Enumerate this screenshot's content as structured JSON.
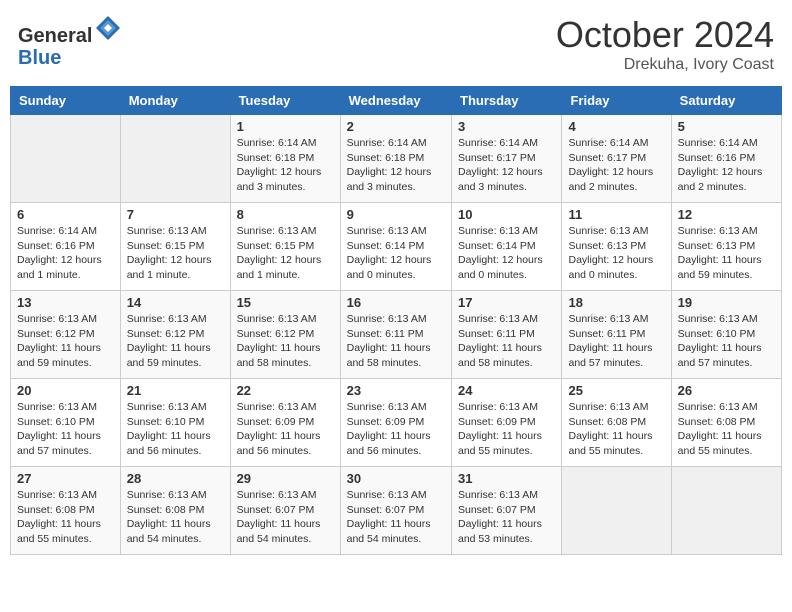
{
  "header": {
    "logo_line1": "General",
    "logo_line2": "Blue",
    "month": "October 2024",
    "location": "Drekuha, Ivory Coast"
  },
  "weekdays": [
    "Sunday",
    "Monday",
    "Tuesday",
    "Wednesday",
    "Thursday",
    "Friday",
    "Saturday"
  ],
  "weeks": [
    [
      {
        "day": "",
        "info": ""
      },
      {
        "day": "",
        "info": ""
      },
      {
        "day": "1",
        "info": "Sunrise: 6:14 AM\nSunset: 6:18 PM\nDaylight: 12 hours and 3 minutes."
      },
      {
        "day": "2",
        "info": "Sunrise: 6:14 AM\nSunset: 6:18 PM\nDaylight: 12 hours and 3 minutes."
      },
      {
        "day": "3",
        "info": "Sunrise: 6:14 AM\nSunset: 6:17 PM\nDaylight: 12 hours and 3 minutes."
      },
      {
        "day": "4",
        "info": "Sunrise: 6:14 AM\nSunset: 6:17 PM\nDaylight: 12 hours and 2 minutes."
      },
      {
        "day": "5",
        "info": "Sunrise: 6:14 AM\nSunset: 6:16 PM\nDaylight: 12 hours and 2 minutes."
      }
    ],
    [
      {
        "day": "6",
        "info": "Sunrise: 6:14 AM\nSunset: 6:16 PM\nDaylight: 12 hours and 1 minute."
      },
      {
        "day": "7",
        "info": "Sunrise: 6:13 AM\nSunset: 6:15 PM\nDaylight: 12 hours and 1 minute."
      },
      {
        "day": "8",
        "info": "Sunrise: 6:13 AM\nSunset: 6:15 PM\nDaylight: 12 hours and 1 minute."
      },
      {
        "day": "9",
        "info": "Sunrise: 6:13 AM\nSunset: 6:14 PM\nDaylight: 12 hours and 0 minutes."
      },
      {
        "day": "10",
        "info": "Sunrise: 6:13 AM\nSunset: 6:14 PM\nDaylight: 12 hours and 0 minutes."
      },
      {
        "day": "11",
        "info": "Sunrise: 6:13 AM\nSunset: 6:13 PM\nDaylight: 12 hours and 0 minutes."
      },
      {
        "day": "12",
        "info": "Sunrise: 6:13 AM\nSunset: 6:13 PM\nDaylight: 11 hours and 59 minutes."
      }
    ],
    [
      {
        "day": "13",
        "info": "Sunrise: 6:13 AM\nSunset: 6:12 PM\nDaylight: 11 hours and 59 minutes."
      },
      {
        "day": "14",
        "info": "Sunrise: 6:13 AM\nSunset: 6:12 PM\nDaylight: 11 hours and 59 minutes."
      },
      {
        "day": "15",
        "info": "Sunrise: 6:13 AM\nSunset: 6:12 PM\nDaylight: 11 hours and 58 minutes."
      },
      {
        "day": "16",
        "info": "Sunrise: 6:13 AM\nSunset: 6:11 PM\nDaylight: 11 hours and 58 minutes."
      },
      {
        "day": "17",
        "info": "Sunrise: 6:13 AM\nSunset: 6:11 PM\nDaylight: 11 hours and 58 minutes."
      },
      {
        "day": "18",
        "info": "Sunrise: 6:13 AM\nSunset: 6:11 PM\nDaylight: 11 hours and 57 minutes."
      },
      {
        "day": "19",
        "info": "Sunrise: 6:13 AM\nSunset: 6:10 PM\nDaylight: 11 hours and 57 minutes."
      }
    ],
    [
      {
        "day": "20",
        "info": "Sunrise: 6:13 AM\nSunset: 6:10 PM\nDaylight: 11 hours and 57 minutes."
      },
      {
        "day": "21",
        "info": "Sunrise: 6:13 AM\nSunset: 6:10 PM\nDaylight: 11 hours and 56 minutes."
      },
      {
        "day": "22",
        "info": "Sunrise: 6:13 AM\nSunset: 6:09 PM\nDaylight: 11 hours and 56 minutes."
      },
      {
        "day": "23",
        "info": "Sunrise: 6:13 AM\nSunset: 6:09 PM\nDaylight: 11 hours and 56 minutes."
      },
      {
        "day": "24",
        "info": "Sunrise: 6:13 AM\nSunset: 6:09 PM\nDaylight: 11 hours and 55 minutes."
      },
      {
        "day": "25",
        "info": "Sunrise: 6:13 AM\nSunset: 6:08 PM\nDaylight: 11 hours and 55 minutes."
      },
      {
        "day": "26",
        "info": "Sunrise: 6:13 AM\nSunset: 6:08 PM\nDaylight: 11 hours and 55 minutes."
      }
    ],
    [
      {
        "day": "27",
        "info": "Sunrise: 6:13 AM\nSunset: 6:08 PM\nDaylight: 11 hours and 55 minutes."
      },
      {
        "day": "28",
        "info": "Sunrise: 6:13 AM\nSunset: 6:08 PM\nDaylight: 11 hours and 54 minutes."
      },
      {
        "day": "29",
        "info": "Sunrise: 6:13 AM\nSunset: 6:07 PM\nDaylight: 11 hours and 54 minutes."
      },
      {
        "day": "30",
        "info": "Sunrise: 6:13 AM\nSunset: 6:07 PM\nDaylight: 11 hours and 54 minutes."
      },
      {
        "day": "31",
        "info": "Sunrise: 6:13 AM\nSunset: 6:07 PM\nDaylight: 11 hours and 53 minutes."
      },
      {
        "day": "",
        "info": ""
      },
      {
        "day": "",
        "info": ""
      }
    ]
  ]
}
